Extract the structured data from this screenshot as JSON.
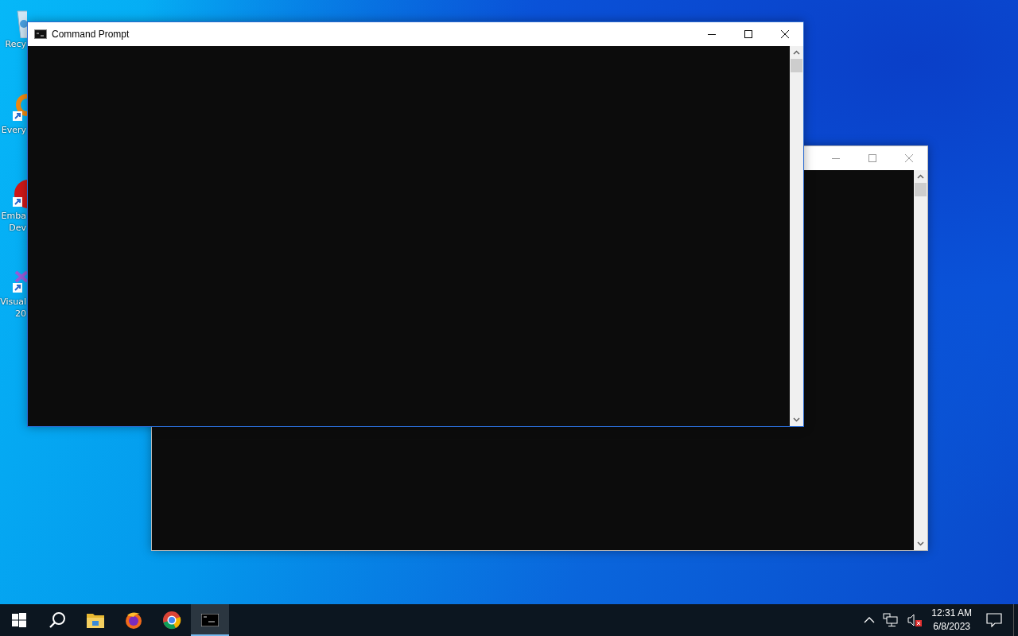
{
  "desktop_icons": [
    {
      "kind": "recycle",
      "lines": [
        "Recy"
      ]
    },
    {
      "kind": "magnifier",
      "lines": [
        "Every"
      ]
    },
    {
      "kind": "ide",
      "lines": [
        "Emba",
        "Dev"
      ]
    },
    {
      "kind": "studio",
      "lines": [
        "Visual",
        "20"
      ]
    }
  ],
  "windows": [
    {
      "title": "Command Prompt",
      "active": true
    },
    {
      "active": false
    }
  ],
  "taskbar": {
    "buttons": [
      {
        "kind": "start"
      },
      {
        "kind": "search"
      }
    ],
    "apps": [
      {
        "kind": "explorer",
        "selected": false
      },
      {
        "kind": "firefox",
        "selected": false
      },
      {
        "kind": "chrome",
        "selected": false
      },
      {
        "kind": "console",
        "selected": true
      }
    ],
    "tray": {
      "volume_muted": true,
      "time": "12:31 AM",
      "date": "6/8/2023"
    }
  }
}
